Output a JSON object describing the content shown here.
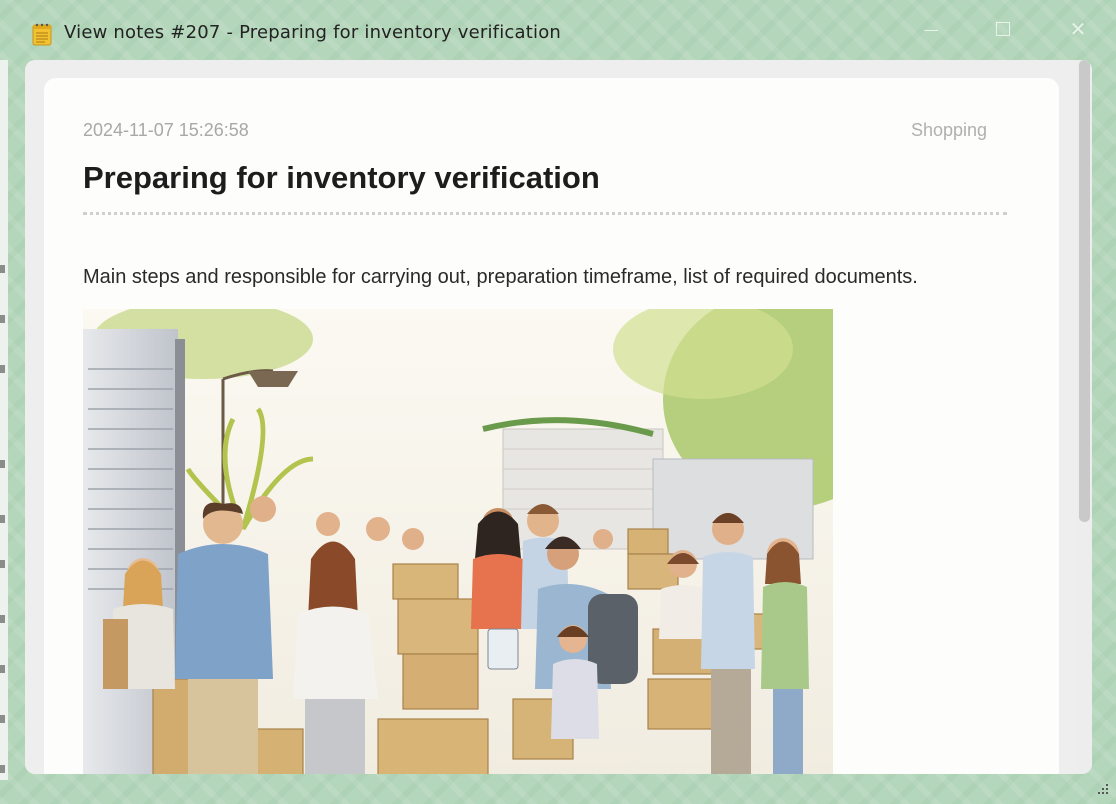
{
  "window": {
    "title": "View notes #207 - Preparing for inventory verification",
    "title_icon": "notepad-icon",
    "controls": [
      "minimize-icon",
      "maximize-icon",
      "close-icon"
    ]
  },
  "note": {
    "date": "2024-11-07 15:26:58",
    "category": "Shopping",
    "title": "Preparing for inventory verification",
    "body": "Main steps and responsible for carrying out, preparation timeframe, list of required documents.",
    "image_icon": "inventory-illustration"
  },
  "colors": {
    "frame": "#b4d6bb",
    "card": "#fdfdfb",
    "title_text": "#1d1d1d",
    "meta_text": "#a8a8a8"
  }
}
